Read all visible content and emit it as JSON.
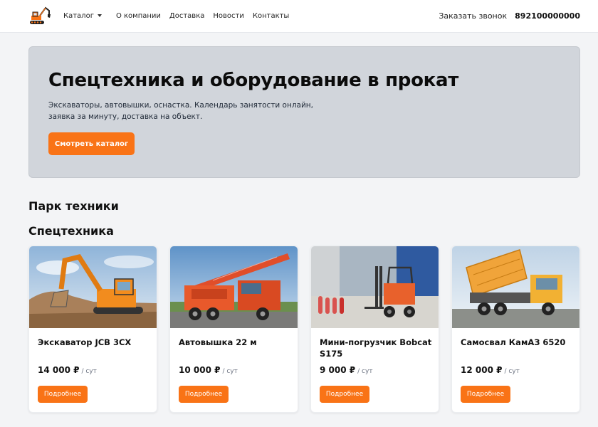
{
  "header": {
    "nav": {
      "catalog": "Каталог",
      "about": "О компании",
      "delivery": "Доставка",
      "news": "Новости",
      "contacts": "Контакты"
    },
    "callback": "Заказать звонок",
    "phone": "892100000000"
  },
  "hero": {
    "title": "Спецтехника и оборудование в прокат",
    "subtitle": "Экскаваторы, автовышки, оснастка. Календарь занятости онлайн, заявка за минуту, доставка на объект.",
    "button": "Смотреть каталог"
  },
  "sections": {
    "fleet": "Парк техники",
    "category": "Спецтехника"
  },
  "products": [
    {
      "title": "Экскаватор JCB 3CX",
      "price": "14 000 ₽",
      "unit": "/ сут",
      "button": "Подробнее"
    },
    {
      "title": "Автовышка 22 м",
      "price": "10 000 ₽",
      "unit": "/ сут",
      "button": "Подробнее"
    },
    {
      "title": "Мини-погрузчик Bobcat S175",
      "price": "9 000 ₽",
      "unit": "/ сут",
      "button": "Подробнее"
    },
    {
      "title": "Самосвал КамАЗ 6520",
      "price": "12 000 ₽",
      "unit": "/ сут",
      "button": "Подробнее"
    }
  ],
  "colors": {
    "accent": "#f97316",
    "hero_bg": "#d1d5db",
    "page_bg": "#f3f4f6"
  }
}
